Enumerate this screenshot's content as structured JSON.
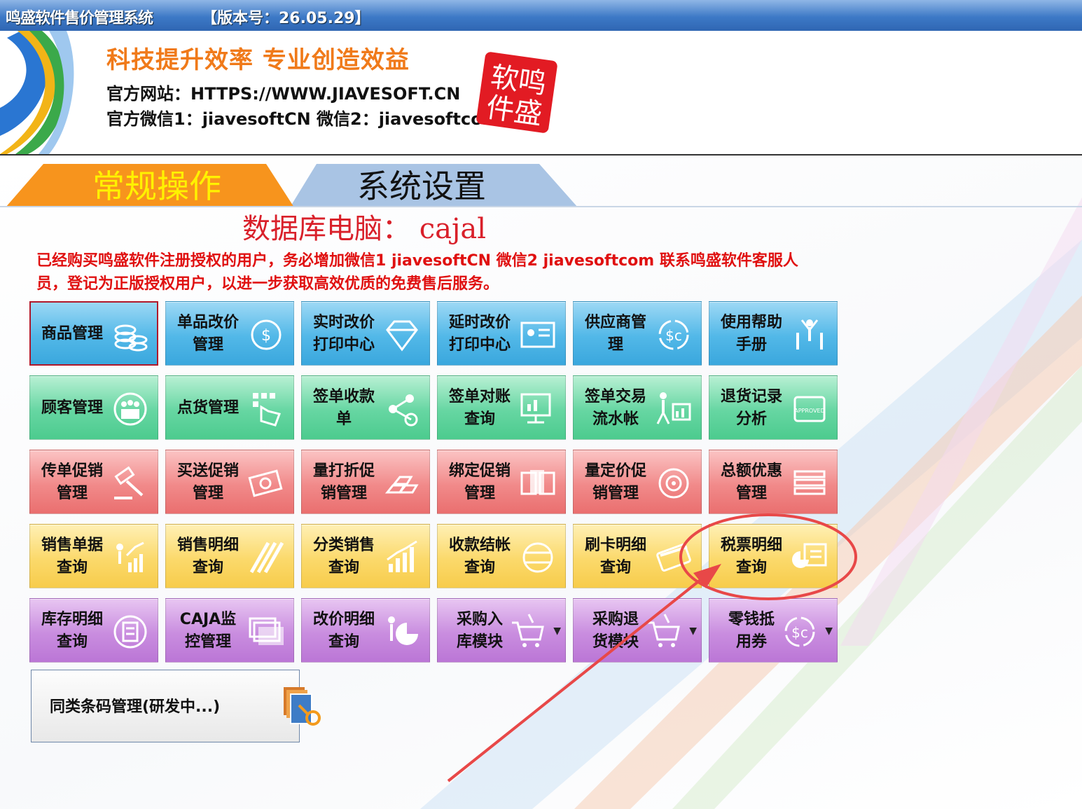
{
  "window": {
    "title": "鸣盛软件售价管理系统",
    "version": "【版本号：26.05.29】"
  },
  "header": {
    "slogan": "科技提升效率   专业创造效益",
    "website": "官方网站：HTTPS://WWW.JIAVESOFT.CN",
    "wechat": "官方微信1：jiavesoftCN  微信2：jiavesoftcom",
    "seal_text": "鸣盛软件"
  },
  "tabs": {
    "active": "常规操作",
    "inactive": "系统设置"
  },
  "database_line": "数据库电脑：  cajal",
  "notice": "已经购买鸣盛软件注册授权的用户，务必增加微信1  jiavesoftCN   微信2  jiavesoftcom  联系鸣盛软件客服人员，登记为正版授权用户，以进一步获取高效优质的免费售后服务。",
  "rows": [
    {
      "color": "blue",
      "buttons": [
        {
          "label": "商品管理",
          "icon": "coins-stack-icon",
          "selected": true
        },
        {
          "label": "单品改价\n管理",
          "icon": "price-dial-icon"
        },
        {
          "label": "实时改价\n打印中心",
          "icon": "diamond-icon"
        },
        {
          "label": "延时改价\n打印中心",
          "icon": "id-card-icon"
        },
        {
          "label": "供应商管\n理",
          "icon": "dollar-cycle-icon"
        },
        {
          "label": "使用帮助\n手册",
          "icon": "people-raise-icon"
        }
      ]
    },
    {
      "color": "green",
      "buttons": [
        {
          "label": "顾客管理",
          "icon": "customers-icon"
        },
        {
          "label": "点货管理",
          "icon": "hand-grid-icon"
        },
        {
          "label": "签单收款\n单",
          "icon": "nodes-icon"
        },
        {
          "label": "签单对账\n查询",
          "icon": "monitor-chart-icon"
        },
        {
          "label": "签单交易\n流水帐",
          "icon": "walker-chart-icon"
        },
        {
          "label": "退货记录\n分析",
          "icon": "approved-stamp-icon"
        }
      ]
    },
    {
      "color": "red",
      "buttons": [
        {
          "label": "传单促销\n管理",
          "icon": "gavel-icon"
        },
        {
          "label": "买送促销\n管理",
          "icon": "cash-bundle-icon"
        },
        {
          "label": "量打折促\n销管理",
          "icon": "gold-bars-icon"
        },
        {
          "label": "绑定促销\n管理",
          "icon": "banknotes-icon"
        },
        {
          "label": "量定价促\n销管理",
          "icon": "target-icon"
        },
        {
          "label": "总额优惠\n管理",
          "icon": "money-stack-icon"
        }
      ]
    },
    {
      "color": "yellow",
      "buttons": [
        {
          "label": "销售单据\n查询",
          "icon": "growth-people-icon"
        },
        {
          "label": "销售明细\n查询",
          "icon": "stripes-icon"
        },
        {
          "label": "分类销售\n查询",
          "icon": "bar-chart-icon"
        },
        {
          "label": "收款结帐\n查询",
          "icon": "globe-lines-icon"
        },
        {
          "label": "刷卡明细\n查询",
          "icon": "credit-card-icon"
        },
        {
          "label": "税票明细\n查询",
          "icon": "presentation-pie-icon"
        }
      ]
    },
    {
      "color": "purple",
      "buttons": [
        {
          "label": "库存明细\n查询",
          "icon": "checklist-icon"
        },
        {
          "label": "CAJA监\n控管理",
          "icon": "window-stack-icon"
        },
        {
          "label": "改价明细\n查询",
          "icon": "person-pie-icon"
        },
        {
          "label": "采购入\n库模块",
          "icon": "cart-in-icon",
          "dropdown": true
        },
        {
          "label": "采购退\n货模块",
          "icon": "cart-out-icon",
          "dropdown": true
        },
        {
          "label": "零钱抵\n用券",
          "icon": "dollar-cycle-icon",
          "dropdown": true
        }
      ]
    }
  ],
  "wide_button": {
    "label": "同类条码管理(研发中...)",
    "icon": "barcode-key-icon"
  },
  "colors": {
    "title_bar": "#3d79c6",
    "slogan": "#f07a1a",
    "active_tab": "#f7941d",
    "notice": "#e01010",
    "annotation": "#e84848"
  }
}
